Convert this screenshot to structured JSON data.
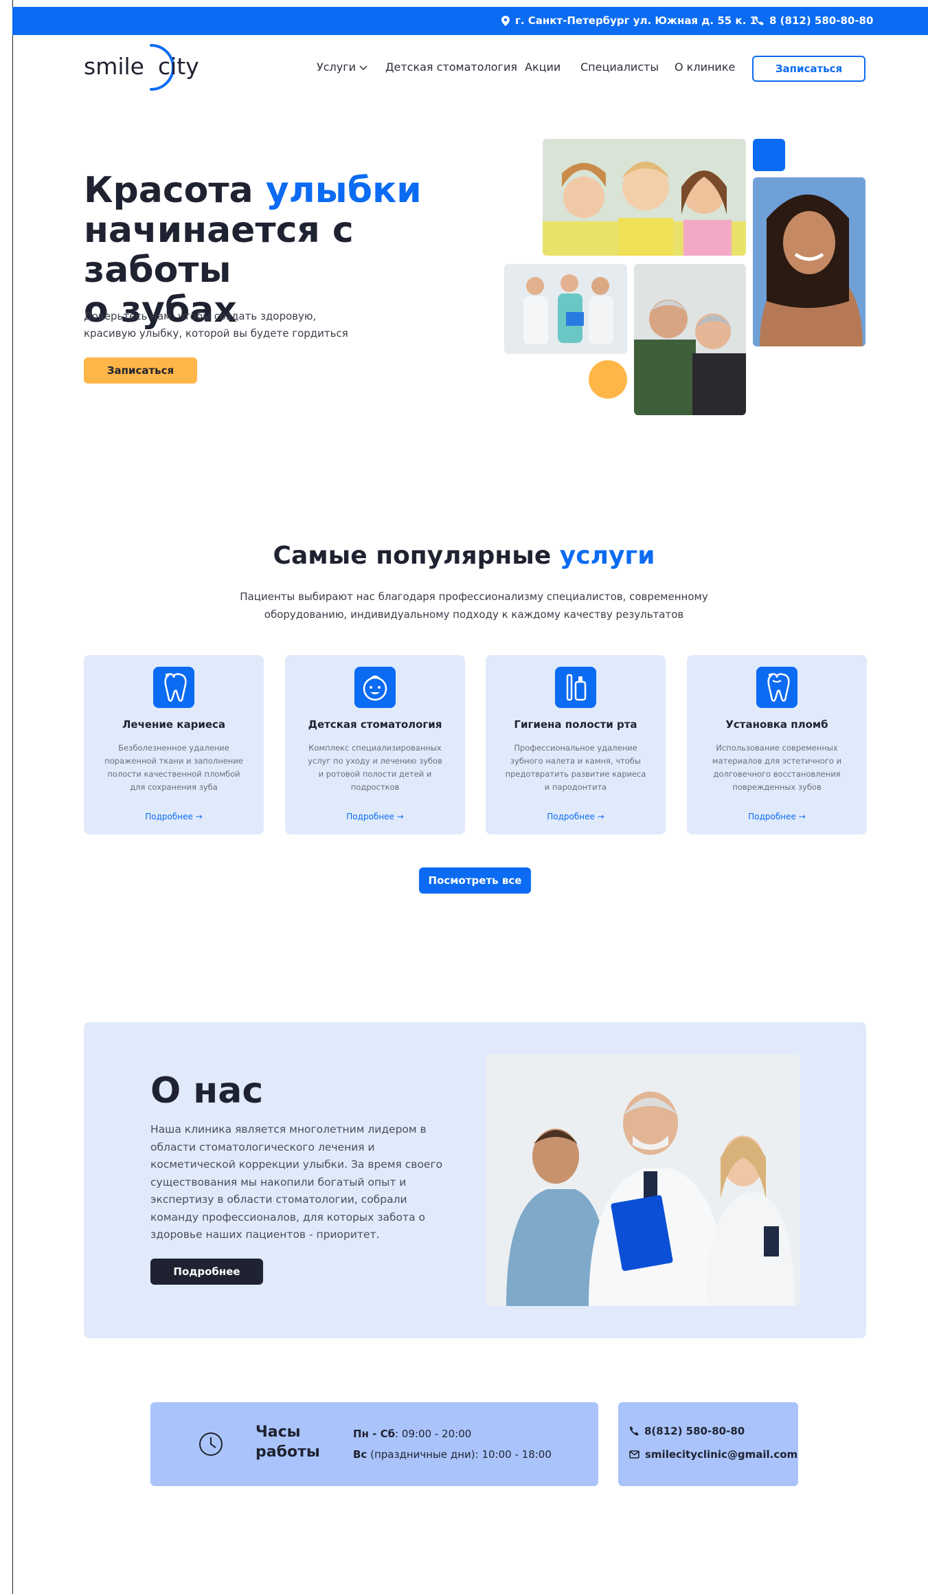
{
  "topbar": {
    "address": "г. Санкт-Петербург ул. Южная д. 55 к. 1",
    "phone": "8 (812) 580-80-80",
    "location_icon": "map-pin-icon",
    "phone_icon": "phone-icon"
  },
  "logo": {
    "text_left": "smile",
    "text_right": "city",
    "accent_color": "#0b6bf2"
  },
  "nav": {
    "items": [
      {
        "label": "Услуги"
      },
      {
        "label": "Детская стоматология"
      },
      {
        "label": "Акции"
      },
      {
        "label": "Специалисты"
      },
      {
        "label": "О клинике"
      }
    ],
    "signup_label": "Записаться"
  },
  "hero": {
    "title_part1": "Красота ",
    "title_accent": "улыбки",
    "title_line2": "начинается с заботы",
    "title_line3": "о зубах",
    "subtitle_line1": "Доверьтесь нам, чтобы создать здоровую,",
    "subtitle_line2": "красивую улыбку, которой вы будете гордиться",
    "cta_label": "Записаться"
  },
  "services": {
    "title_part1": "Самые популярные ",
    "title_accent": "услуги",
    "subtitle_line1": "Пациенты выбирают нас благодаря профессионализму специалистов, современному",
    "subtitle_line2": "оборудованию, индивидуальному подходу к каждому качеству результатов",
    "cards": [
      {
        "icon": "tooth-icon",
        "title": "Лечение кариеса",
        "description": "Безболезненное удаление пораженной ткани и заполнение полости качественной пломбой для сохранения зуба",
        "link": "Подробнее →"
      },
      {
        "icon": "child-face-icon",
        "title": "Детская стоматология",
        "description": "Комплекс специализированных услуг по уходу и лечению зубов и ротовой полости детей и подростков",
        "link": "Подробнее →"
      },
      {
        "icon": "toothbrush-paste-icon",
        "title": "Гигиена полости рта",
        "description": "Профессиональное удаление зубного налета и камня, чтобы предотвратить развитие кариеса и пародонтита",
        "link": "Подробнее →"
      },
      {
        "icon": "tooth-filling-icon",
        "title": "Установка пломб",
        "description": "Использование современных материалов для эстетичного и долговечного восстановления поврежденных зубов",
        "link": "Подробнее →"
      }
    ],
    "view_all_label": "Посмотреть все"
  },
  "about": {
    "title": "О нас",
    "text": "Наша клиника является многолетним лидером в области стоматологического лечения и косметической коррекции улыбки. За время своего существования мы накопили богатый опыт и экспертизу в области стоматологии, собрали команду профессионалов, для которых забота о здоровье наших пациентов - приоритет.",
    "button_label": "Подробнее"
  },
  "hours": {
    "title_line1": "Часы",
    "title_line2": "работы",
    "weekdays_label": "Пн - Сб",
    "weekdays_value": ": 09:00 - 20:00",
    "sunday_label": "Вс",
    "sunday_value": " (праздничные дни): 10:00 - 18:00"
  },
  "contact": {
    "phone": "8(812) 580-80-80",
    "email": "smilecityclinic@gmail.com"
  },
  "colors": {
    "primary": "#0b6bf2",
    "yellow": "#ffb648",
    "dark": "#1f2230",
    "light_blue": "#e0eafb",
    "mid_blue": "#aac4fb"
  }
}
